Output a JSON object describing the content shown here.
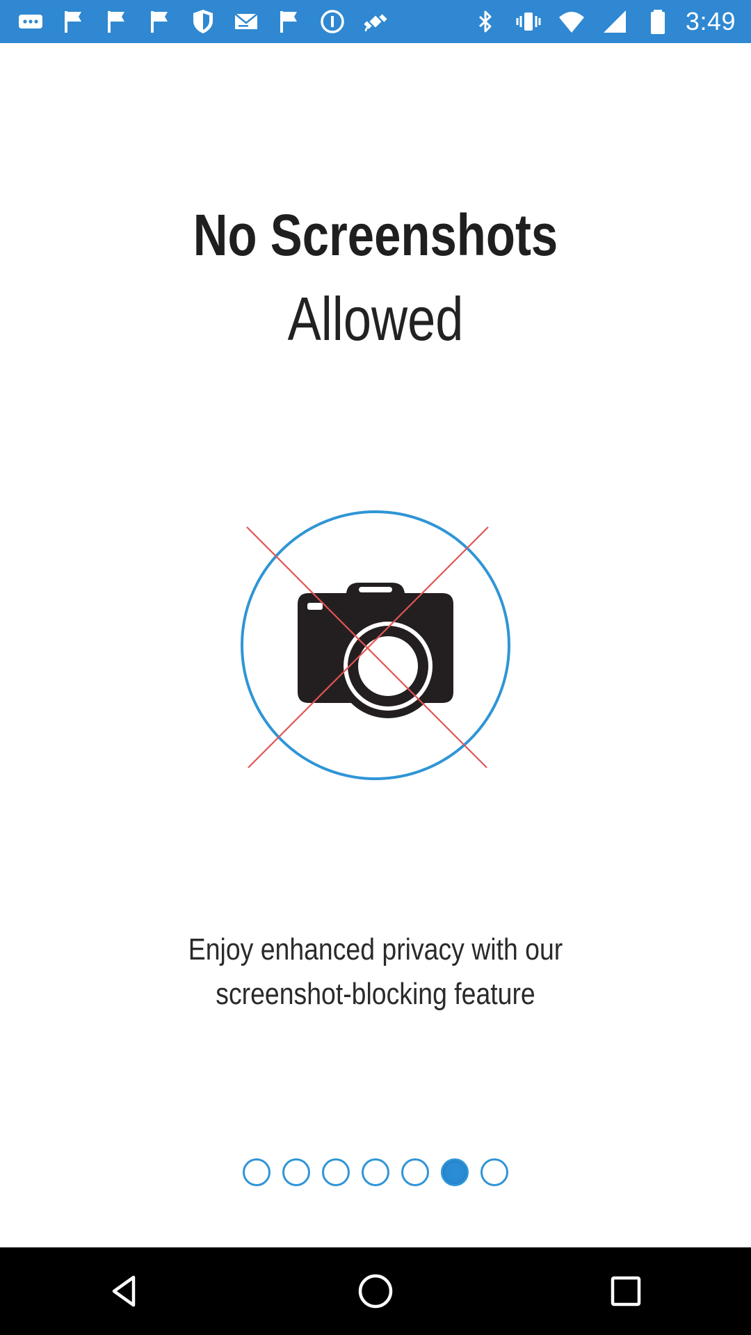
{
  "status_bar": {
    "time": "3:49",
    "background_color": "#2f88d1",
    "left_icons": [
      "more-icon",
      "flag-icon",
      "flag-icon",
      "flag-icon",
      "shield-icon",
      "mail-icon",
      "flag-icon",
      "info-icon",
      "satellite-icon"
    ],
    "right_icons": [
      "bluetooth-icon",
      "vibrate-icon",
      "wifi-icon",
      "signal-icon",
      "battery-icon"
    ]
  },
  "onboarding": {
    "title_line1": "No Screenshots",
    "title_line2": "Allowed",
    "description_line1": "Enjoy enhanced privacy with our",
    "description_line2": "screenshot-blocking feature",
    "illustration_icon": "no-camera-icon",
    "accent_color": "#2f95d6",
    "cross_color": "#e05555"
  },
  "pager": {
    "total_pages": 7,
    "current_page": 6
  },
  "nav_bar": {
    "buttons": [
      "back-icon",
      "home-icon",
      "recents-icon"
    ]
  }
}
